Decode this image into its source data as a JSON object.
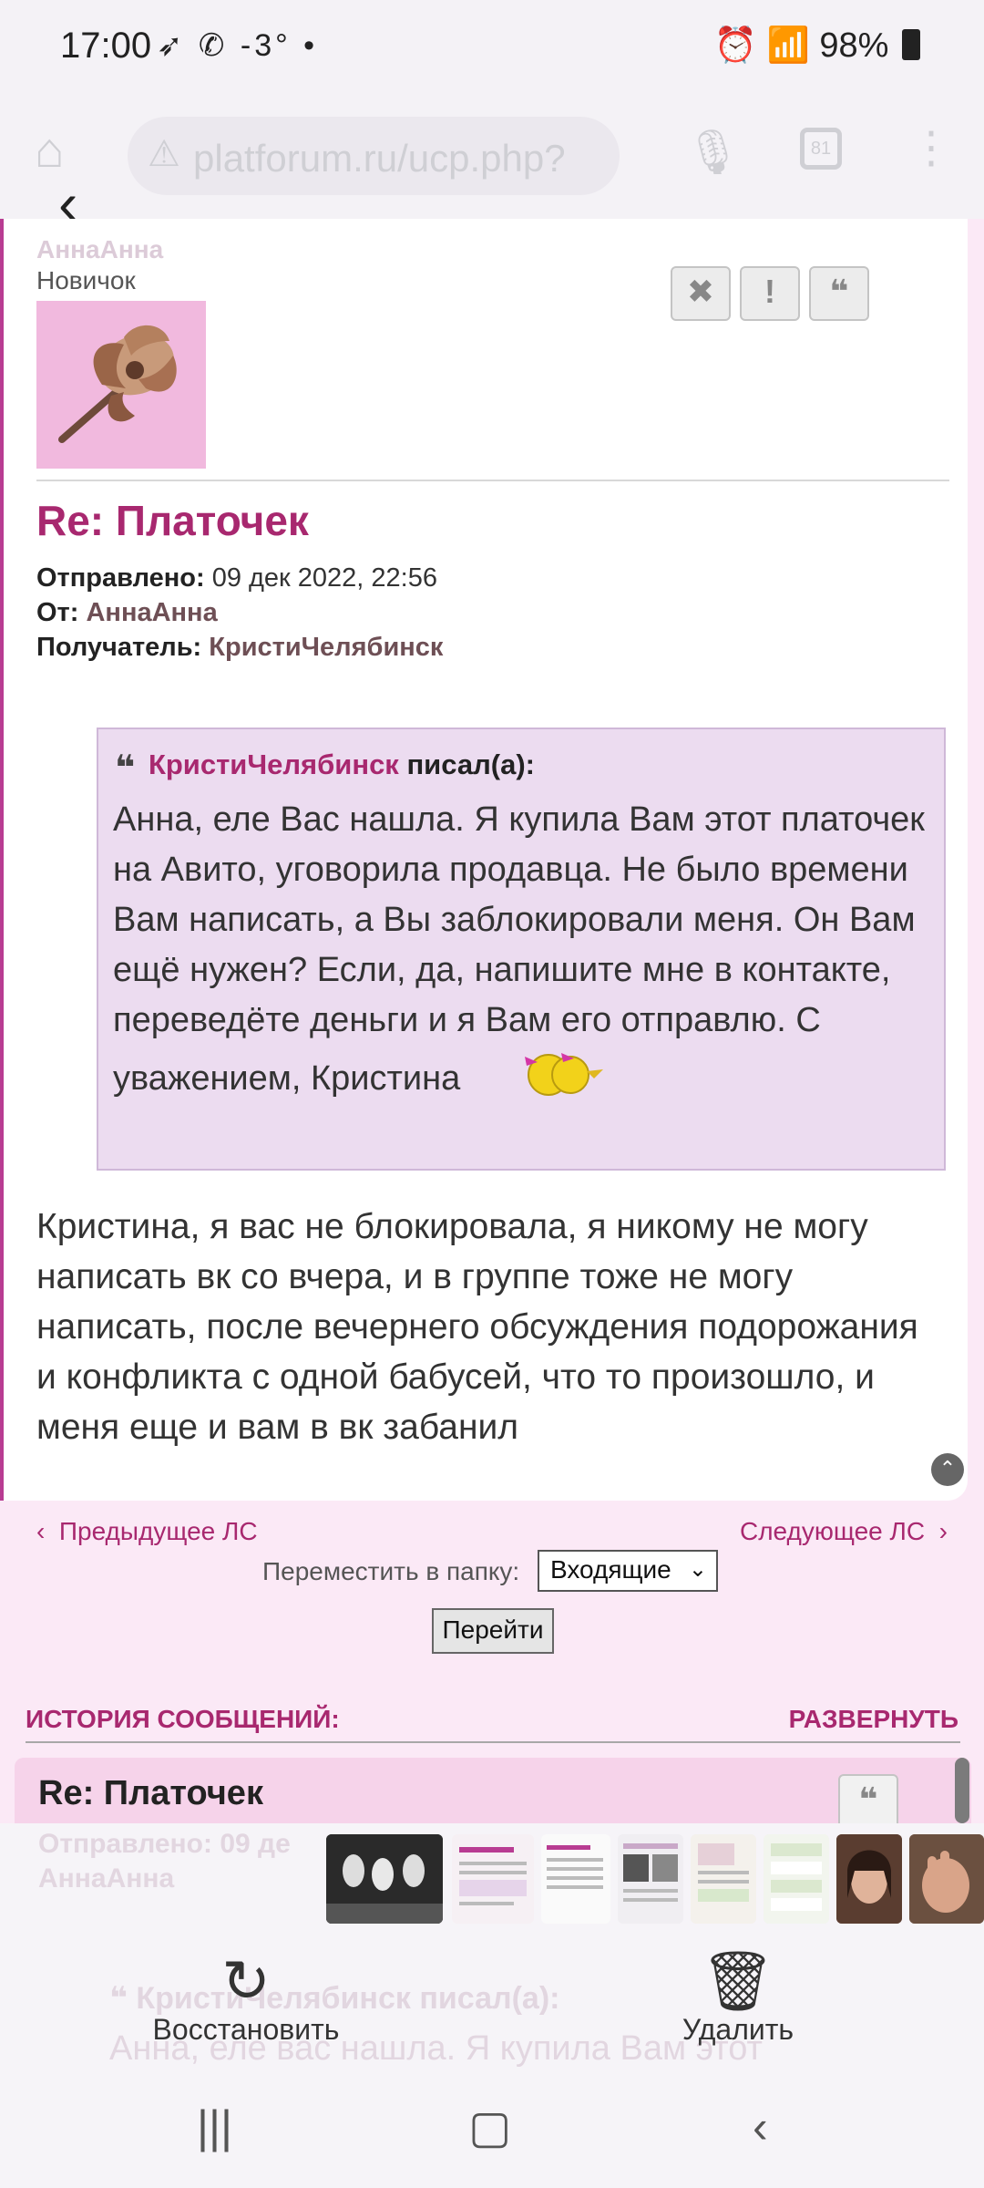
{
  "status_bar": {
    "time": "17:00",
    "indicators": "➶ ✆ -3° •",
    "battery": "98%"
  },
  "browser": {
    "url": "platforum.ru/ucp.php?",
    "tab_count": "81"
  },
  "post": {
    "author_faded": "АннаАнна",
    "rank": "Новичок",
    "title": "Re: Платочек",
    "sent_label": "Отправлено:",
    "sent_value": "09 дек 2022, 22:56",
    "from_label": "От:",
    "from_value": "АннаАнна",
    "to_label": "Получатель:",
    "to_value": "КристиЧелябинск",
    "quote_author": "КристиЧелябинск",
    "quote_wrote": "писал(а):",
    "quote_text": "Анна, еле Вас нашла. Я купила Вам этот платочек на Авито, уговорила продавца. Не было времени Вам написать, а Вы заблокировали меня. Он Вам ещё нужен? Если, да, напишите мне в контакте, переведёте деньги и я Вам его отправлю. С уважением, Кристина",
    "reply_text": "Кристина, я вас не блокировала, я никому не могу написать вк со вчера, и в группе тоже не могу написать, после вечернего обсуждения подорожания и конфликта с одной бабусей, что то произошло, и меня еще и вам в вк забанил"
  },
  "nav": {
    "prev": "Предыдущее ЛС",
    "next": "Следующее ЛС",
    "move_label": "Переместить в папку:",
    "folder": "Входящие",
    "go": "Перейти"
  },
  "history": {
    "title": "ИСТОРИЯ СООБЩЕНИЙ:",
    "expand": "РАЗВЕРНУТЬ",
    "item_title": "Re: Платочек",
    "item_sent": "Отправлено: 09 де",
    "item_author": "АннаАнна",
    "item_quote_author": "КристиЧелябинск",
    "item_quote_wrote": "писал(а):",
    "item_body": "Анна, еле вас нашла. Я купила Вам этот"
  },
  "bottom_sheet": {
    "restore": "Восстановить",
    "delete": "Удалить"
  },
  "colors": {
    "accent": "#a8286f",
    "page_pink": "#fbe9f6",
    "quote_bg": "#ecdcf0"
  }
}
